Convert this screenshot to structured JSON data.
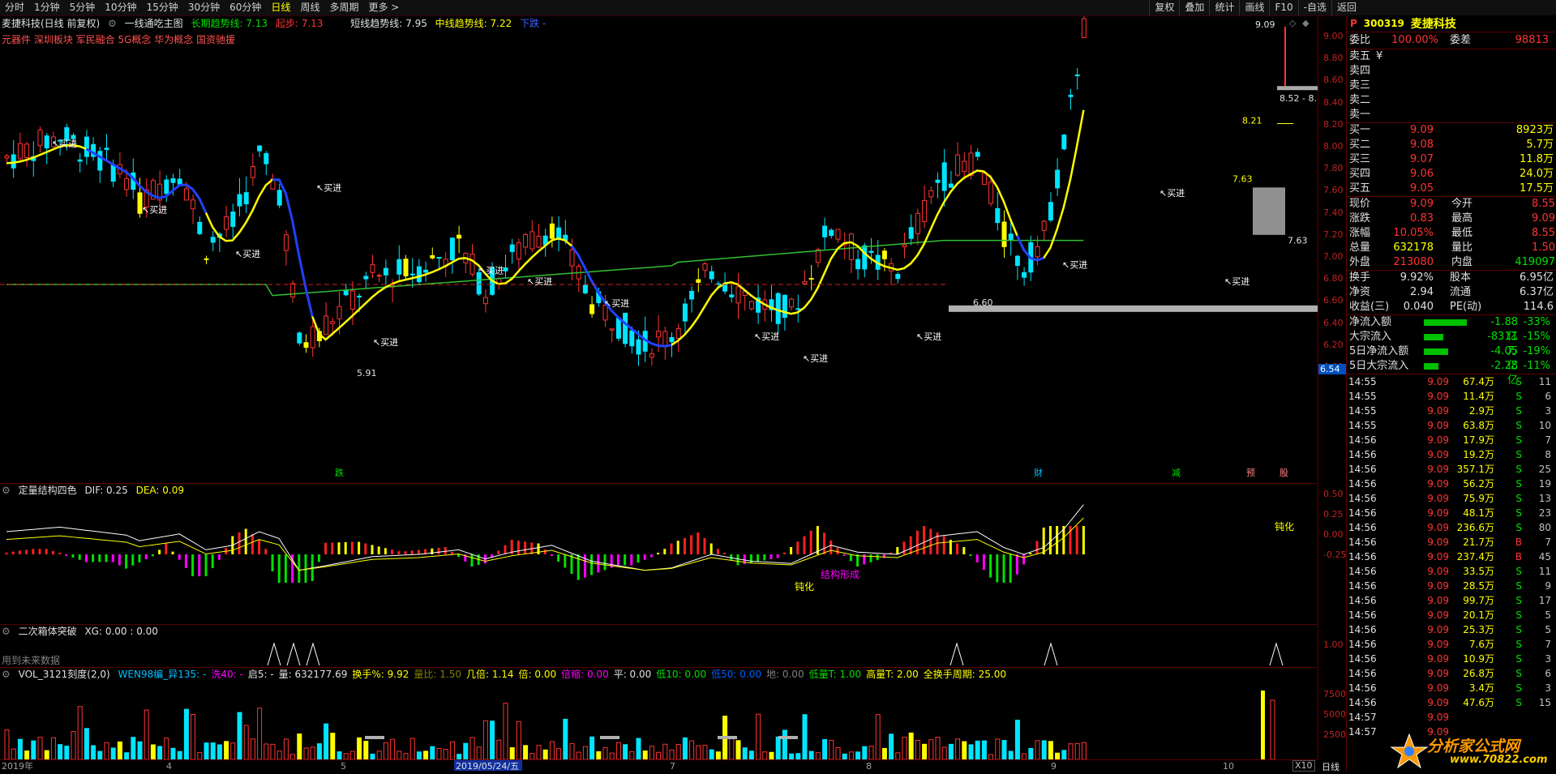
{
  "toolbar": {
    "left": [
      "分时",
      "1分钟",
      "5分钟",
      "10分钟",
      "15分钟",
      "30分钟",
      "60分钟",
      "日线",
      "周线",
      "多周期",
      "更多 >"
    ],
    "active": "日线",
    "right": [
      "复权",
      "叠加",
      "统计",
      "画线",
      "F10",
      "-自选",
      "返回"
    ]
  },
  "main": {
    "title": "麦捷科技(日线 前复权)",
    "indicator": "一线通吃主图",
    "long_trend": "长期趋势线: 7.13",
    "start": "起步: 7.13",
    "short_trend": "短线趋势线: 7.95",
    "mid_trend": "中线趋势线: 7.22",
    "down": "下跌 -",
    "concepts": "元器件 深圳板块 军民融合 5G概念 华为概念 国资驰援",
    "price_ticks": [
      "9.00",
      "8.80",
      "8.60",
      "8.40",
      "8.20",
      "8.00",
      "7.80",
      "7.60",
      "7.40",
      "7.20",
      "7.00",
      "6.80",
      "6.60",
      "6.40",
      "6.20",
      "6.00"
    ],
    "current_price_tag": "6.54",
    "labels": {
      "buy": "买进",
      "die": "跌",
      "cai": "财",
      "jian": "减",
      "yu": "预",
      "ju": "股",
      "low": "5.91",
      "low2": "6.60",
      "hi": "9.09",
      "range": "8.52 - 8.",
      "p821": "8.21",
      "p763a": "7.63",
      "p763b": "7.63"
    }
  },
  "macd": {
    "title": "定量结构四色",
    "dif": "DIF: 0.25",
    "dea": "DEA: 0.09",
    "ticks": [
      "0.50",
      "0.25",
      "0.00",
      "-0.25"
    ],
    "labels": {
      "dunhua": "钝化",
      "jiegou": "结构形成",
      "dunhua2": "钝化"
    }
  },
  "box": {
    "title": "二次箱体突破",
    "xg": "XG: 0.00 : 0.00",
    "note": "用到未来数据",
    "tick": "1.00"
  },
  "vol": {
    "title": "VOL_3121刻度(2,0)",
    "items": [
      {
        "t": "WEN98编_异135: -",
        "c": "#00c0ff"
      },
      {
        "t": "洗40: -",
        "c": "#ff00ff"
      },
      {
        "t": "启5: -",
        "c": "#e0e0e0"
      },
      {
        "t": "量: 632177.69",
        "c": "#e0e0e0"
      },
      {
        "t": "换手%: 9.92",
        "c": "#ffff00"
      },
      {
        "t": "量比: 1.50",
        "c": "#808000"
      },
      {
        "t": "几倍: 1.14",
        "c": "#ffff00"
      },
      {
        "t": "倍: 0.00",
        "c": "#ffff00"
      },
      {
        "t": "倍缩: 0.00",
        "c": "#ff00ff"
      },
      {
        "t": "平: 0.00",
        "c": "#e0e0e0"
      },
      {
        "t": "低10: 0.00",
        "c": "#00e000"
      },
      {
        "t": "低50: 0.00",
        "c": "#0060ff"
      },
      {
        "t": "地: 0.00",
        "c": "#808080"
      },
      {
        "t": "低量T: 1.00",
        "c": "#00e000"
      },
      {
        "t": "高量T: 2.00",
        "c": "#ffff00"
      },
      {
        "t": "全换手周期: 25.00",
        "c": "#ffff00"
      }
    ],
    "ticks": [
      "75000",
      "50000",
      "25000"
    ],
    "x_unit": "X10"
  },
  "xaxis": {
    "labels": [
      "2019年",
      "4",
      "5",
      "2019/05/24/五",
      "7",
      "8",
      "9",
      "10"
    ],
    "period": "日线"
  },
  "quote": {
    "p": "P",
    "code": "300319",
    "name": "麦捷科技",
    "weibi_label": "委比",
    "weibi": "100.00%",
    "weicha_label": "委差",
    "weicha": "98813",
    "sells": [
      {
        "l": "卖五",
        "p": "",
        "v": "",
        "flag": "¥"
      },
      {
        "l": "卖四",
        "p": "",
        "v": ""
      },
      {
        "l": "卖三",
        "p": "",
        "v": ""
      },
      {
        "l": "卖二",
        "p": "",
        "v": ""
      },
      {
        "l": "卖一",
        "p": "",
        "v": ""
      }
    ],
    "buys": [
      {
        "l": "买一",
        "p": "9.09",
        "v": "8923万"
      },
      {
        "l": "买二",
        "p": "9.08",
        "v": "5.7万"
      },
      {
        "l": "买三",
        "p": "9.07",
        "v": "11.8万"
      },
      {
        "l": "买四",
        "p": "9.06",
        "v": "24.0万"
      },
      {
        "l": "买五",
        "p": "9.05",
        "v": "17.5万"
      }
    ],
    "stats": [
      {
        "a": "现价",
        "b": "9.09",
        "c": "今开",
        "d": "8.55",
        "bc": "red",
        "dc": "red"
      },
      {
        "a": "涨跌",
        "b": "0.83",
        "c": "最高",
        "d": "9.09",
        "bc": "red",
        "dc": "red"
      },
      {
        "a": "涨幅",
        "b": "10.05%",
        "c": "最低",
        "d": "8.55",
        "bc": "red",
        "dc": "red"
      },
      {
        "a": "总量",
        "b": "632178",
        "c": "量比",
        "d": "1.50",
        "bc": "yel",
        "dc": "red"
      },
      {
        "a": "外盘",
        "b": "213080",
        "c": "内盘",
        "d": "419097",
        "bc": "red",
        "dc": "grn"
      }
    ],
    "stats2": [
      {
        "a": "换手",
        "b": "9.92%",
        "c": "股本",
        "d": "6.95亿"
      },
      {
        "a": "净资",
        "b": "2.94",
        "c": "流通",
        "d": "6.37亿"
      },
      {
        "a": "收益(三)",
        "b": "0.040",
        "c": "PE(动)",
        "d": "114.6"
      }
    ],
    "flows": [
      {
        "l": "净流入额",
        "v": "-1.88亿",
        "pct": "-33%",
        "bar": 0.33
      },
      {
        "l": "大宗流入",
        "v": "-8311万",
        "pct": "-15%",
        "bar": 0.15
      },
      {
        "l": "5日净流入额",
        "v": "-4.05亿",
        "pct": "-19%",
        "bar": 0.19
      },
      {
        "l": "5日大宗流入",
        "v": "-2.28亿",
        "pct": "-11%",
        "bar": 0.11
      }
    ],
    "ticks": [
      {
        "t": "14:55",
        "p": "9.09",
        "v": "67.4万",
        "s": "S",
        "n": "11"
      },
      {
        "t": "14:55",
        "p": "9.09",
        "v": "11.4万",
        "s": "S",
        "n": "6"
      },
      {
        "t": "14:55",
        "p": "9.09",
        "v": "2.9万",
        "s": "S",
        "n": "3"
      },
      {
        "t": "14:55",
        "p": "9.09",
        "v": "63.8万",
        "s": "S",
        "n": "10"
      },
      {
        "t": "14:56",
        "p": "9.09",
        "v": "17.9万",
        "s": "S",
        "n": "7"
      },
      {
        "t": "14:56",
        "p": "9.09",
        "v": "19.2万",
        "s": "S",
        "n": "8"
      },
      {
        "t": "14:56",
        "p": "9.09",
        "v": "357.1万",
        "s": "S",
        "n": "25"
      },
      {
        "t": "14:56",
        "p": "9.09",
        "v": "56.2万",
        "s": "S",
        "n": "19"
      },
      {
        "t": "14:56",
        "p": "9.09",
        "v": "75.9万",
        "s": "S",
        "n": "13"
      },
      {
        "t": "14:56",
        "p": "9.09",
        "v": "48.1万",
        "s": "S",
        "n": "23"
      },
      {
        "t": "14:56",
        "p": "9.09",
        "v": "236.6万",
        "s": "S",
        "n": "80"
      },
      {
        "t": "14:56",
        "p": "9.09",
        "v": "21.7万",
        "s": "B",
        "n": "7"
      },
      {
        "t": "14:56",
        "p": "9.09",
        "v": "237.4万",
        "s": "B",
        "n": "45"
      },
      {
        "t": "14:56",
        "p": "9.09",
        "v": "33.5万",
        "s": "S",
        "n": "11"
      },
      {
        "t": "14:56",
        "p": "9.09",
        "v": "28.5万",
        "s": "S",
        "n": "9"
      },
      {
        "t": "14:56",
        "p": "9.09",
        "v": "99.7万",
        "s": "S",
        "n": "17"
      },
      {
        "t": "14:56",
        "p": "9.09",
        "v": "20.1万",
        "s": "S",
        "n": "5"
      },
      {
        "t": "14:56",
        "p": "9.09",
        "v": "25.3万",
        "s": "S",
        "n": "5"
      },
      {
        "t": "14:56",
        "p": "9.09",
        "v": "7.6万",
        "s": "S",
        "n": "7"
      },
      {
        "t": "14:56",
        "p": "9.09",
        "v": "10.9万",
        "s": "S",
        "n": "3"
      },
      {
        "t": "14:56",
        "p": "9.09",
        "v": "26.8万",
        "s": "S",
        "n": "6"
      },
      {
        "t": "14:56",
        "p": "9.09",
        "v": "3.4万",
        "s": "S",
        "n": "3"
      },
      {
        "t": "14:56",
        "p": "9.09",
        "v": "47.6万",
        "s": "S",
        "n": "15"
      },
      {
        "t": "14:57",
        "p": "9.09",
        "v": "",
        "s": "",
        "n": ""
      },
      {
        "t": "14:57",
        "p": "9.09",
        "v": "",
        "s": "",
        "n": ""
      }
    ]
  },
  "watermark": {
    "site": "分析家公式网",
    "url": "www.70822.com"
  }
}
